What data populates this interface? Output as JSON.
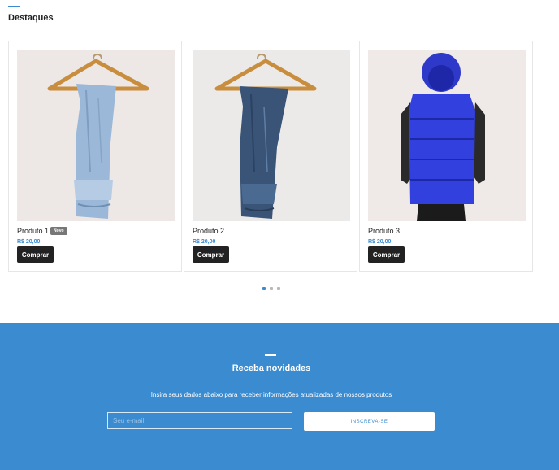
{
  "section": {
    "title": "Destaques"
  },
  "products": [
    {
      "name": "Produto 1",
      "badge": "Novo",
      "price": "R$ 20,00",
      "buy_label": "Comprar",
      "image": "light-jeans-on-hanger"
    },
    {
      "name": "Produto 2",
      "badge": "",
      "price": "R$ 20,00",
      "buy_label": "Comprar",
      "image": "dark-jeans-on-hanger"
    },
    {
      "name": "Produto 3",
      "badge": "",
      "price": "R$ 20,00",
      "buy_label": "Comprar",
      "image": "blue-puffer-vest"
    }
  ],
  "carousel": {
    "pages": 3,
    "active": 1
  },
  "newsletter": {
    "title": "Receba novidades",
    "description": "Insira seus dados abaixo para receber informações atualizadas de nossos produtos",
    "email_placeholder": "Seu e-mail",
    "button_label": "INSCREVA-SE"
  },
  "colors": {
    "accent": "#3b8bd0",
    "button_dark": "#222222",
    "badge": "#777777"
  }
}
